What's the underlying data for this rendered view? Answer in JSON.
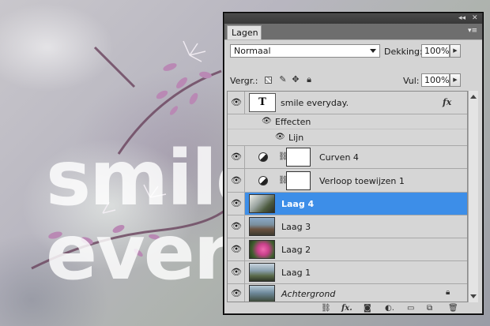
{
  "canvas": {
    "line1": "smile",
    "line2": "every"
  },
  "panel": {
    "tab_label": "Lagen",
    "title_controls": [
      "◂◂",
      "✕"
    ],
    "menu_icon": "panel-menu-icon",
    "blend_mode": "Normaal",
    "opacity_label": "Dekking:",
    "opacity_value": "100%",
    "lock_label": "Vergr.:",
    "fill_label": "Vul:",
    "fill_value": "100%",
    "layers": [
      {
        "name": "smile everyday.",
        "type": "text",
        "thumb_label": "T",
        "fx": "fx"
      },
      {
        "name": "Effecten",
        "type": "effects-group"
      },
      {
        "name": "Lijn",
        "type": "effect"
      },
      {
        "name": "Curven 4",
        "type": "adjustment"
      },
      {
        "name": "Verloop toewijzen 1",
        "type": "adjustment"
      },
      {
        "name": "Laag 4",
        "type": "image",
        "selected": true
      },
      {
        "name": "Laag 3",
        "type": "image"
      },
      {
        "name": "Laag 2",
        "type": "image"
      },
      {
        "name": "Laag 1",
        "type": "image"
      },
      {
        "name": "Achtergrond",
        "type": "background",
        "locked": true
      }
    ],
    "footer_icons": [
      "link-layers-icon",
      "fx-icon",
      "mask-icon",
      "adjustment-icon",
      "folder-icon",
      "new-layer-icon",
      "trash-icon"
    ]
  },
  "colors": {
    "selection": "#3d8ee8",
    "panel_bg": "#d4d4d4"
  }
}
